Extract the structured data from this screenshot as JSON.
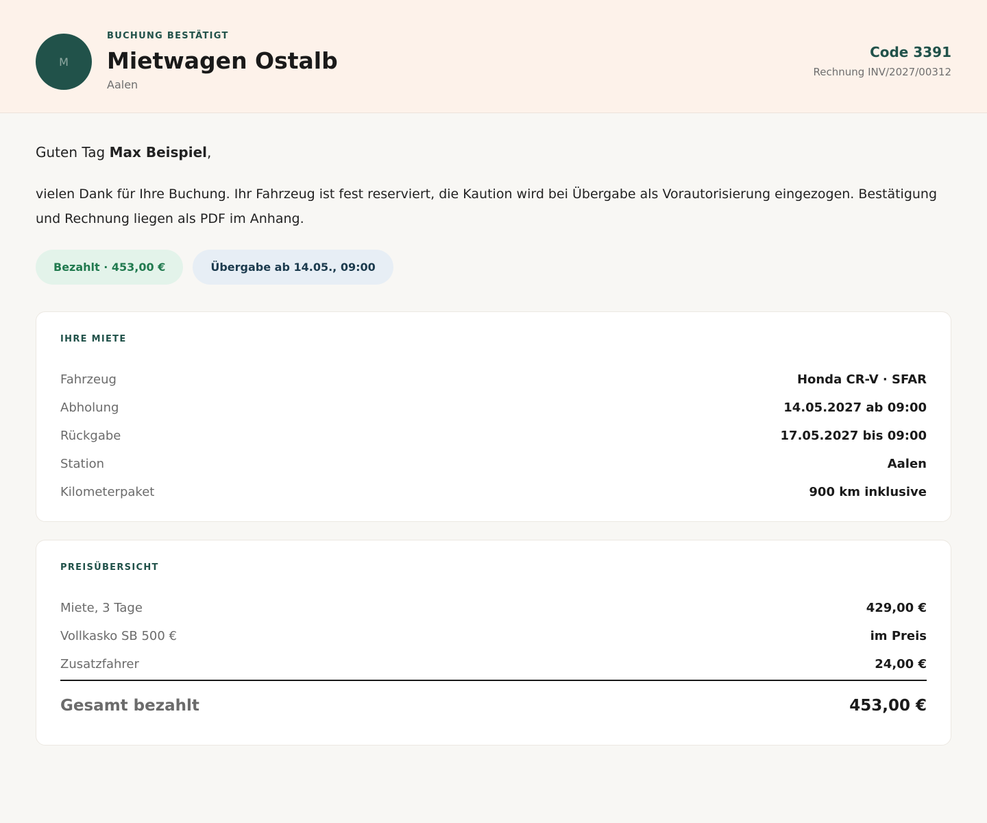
{
  "header": {
    "avatar_letter": "M",
    "kicker": "BUCHUNG BESTÄTIGT",
    "company": "Mietwagen Ostalb",
    "city": "Aalen",
    "code": "Code 3391",
    "invoice": "Rechnung INV/2027/00312"
  },
  "greeting": {
    "prefix": "Guten Tag ",
    "name": "Max Beispiel",
    "suffix": ","
  },
  "message": "vielen Dank für Ihre Buchung. Ihr Fahrzeug ist fest reserviert, die Kaution wird bei Übergabe als Vorautorisierung eingezogen. Bestätigung und Rechnung liegen als PDF im Anhang.",
  "badges": {
    "paid": "Bezahlt · 453,00 €",
    "handover": "Übergabe ab 14.05., 09:00"
  },
  "rental": {
    "title": "IHRE MIETE",
    "rows": [
      {
        "label": "Fahrzeug",
        "value": "Honda CR-V · SFAR"
      },
      {
        "label": "Abholung",
        "value": "14.05.2027 ab 09:00"
      },
      {
        "label": "Rückgabe",
        "value": "17.05.2027 bis 09:00"
      },
      {
        "label": "Station",
        "value": "Aalen"
      },
      {
        "label": "Kilometerpaket",
        "value": "900 km inklusive"
      }
    ]
  },
  "prices": {
    "title": "PREISÜBERSICHT",
    "rows": [
      {
        "label": "Miete, 3 Tage",
        "value": "429,00 €"
      },
      {
        "label": "Vollkasko SB 500 €",
        "value": "im Preis"
      },
      {
        "label": "Zusatzfahrer",
        "value": "24,00 €"
      }
    ],
    "total_label": "Gesamt bezahlt",
    "total_value": "453,00 €"
  },
  "colors": {
    "accent": "#21524a",
    "header_bg": "#fdf2ea",
    "paid_badge_bg": "#e3f3ea",
    "paid_badge_text": "#217a4f",
    "handover_badge_bg": "#e7eef5"
  }
}
